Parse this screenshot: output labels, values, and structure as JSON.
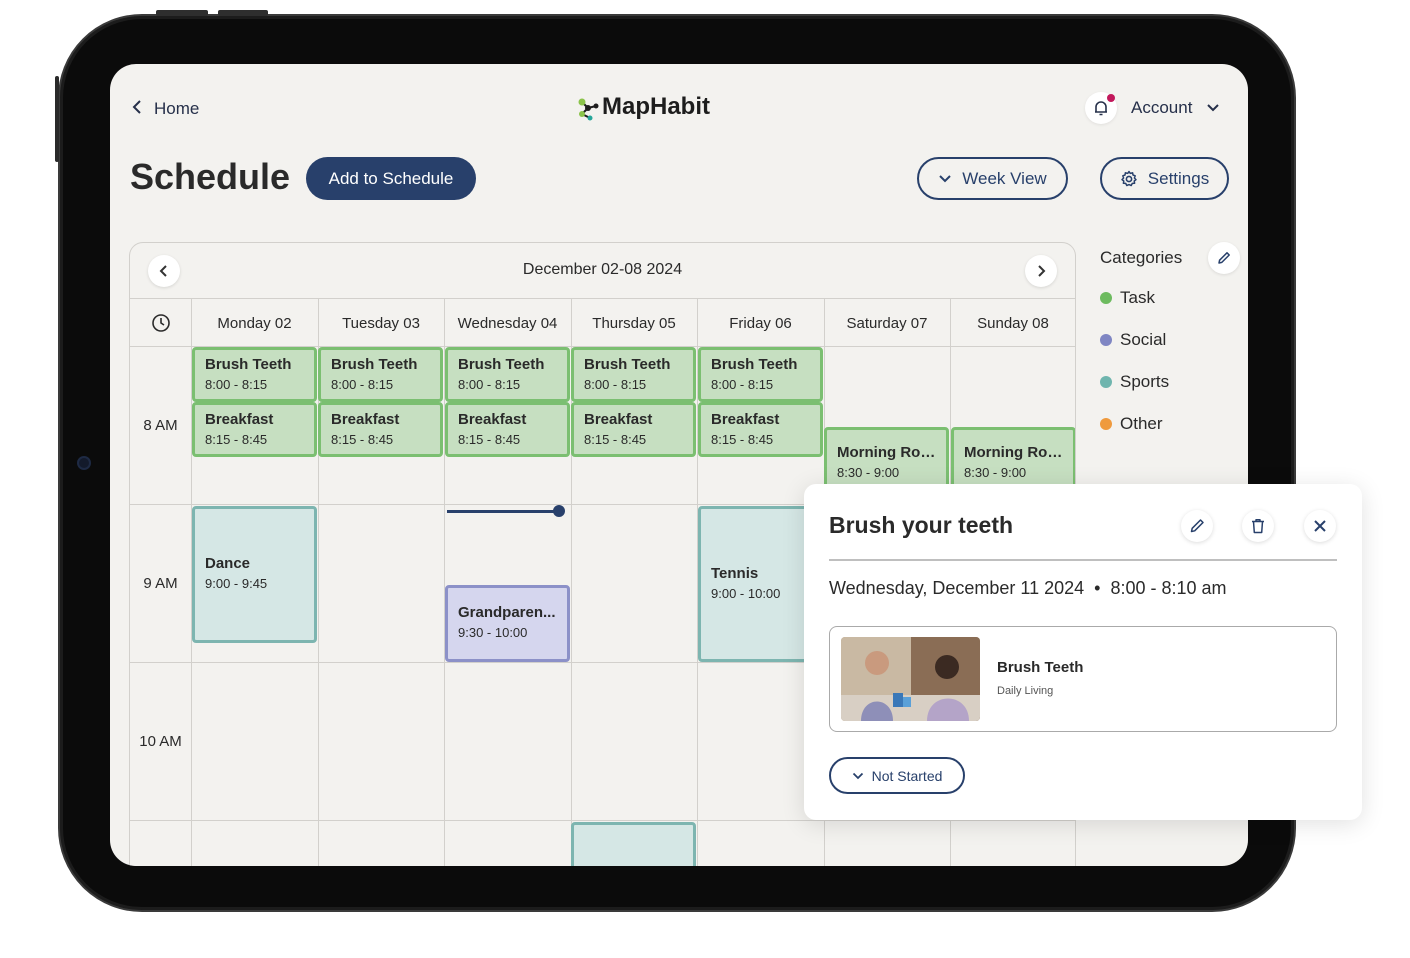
{
  "header": {
    "home_label": "Home",
    "brand": "MapHabit",
    "account_label": "Account"
  },
  "page": {
    "title": "Schedule",
    "add_button": "Add to Schedule",
    "view_button": "Week View",
    "settings_button": "Settings"
  },
  "calendar": {
    "range": "December 02-08 2024",
    "days": [
      "Monday 02",
      "Tuesday 03",
      "Wednesday 04",
      "Thursday 05",
      "Friday 06",
      "Saturday 07",
      "Sunday 08"
    ],
    "hours": [
      "8 AM",
      "9 AM",
      "10 AM"
    ],
    "events": [
      {
        "title": "Brush Teeth",
        "time": "8:00 - 8:15",
        "category": "Task"
      },
      {
        "title": "Breakfast",
        "time": "8:15 - 8:45",
        "category": "Task"
      },
      {
        "title": "Morning Rou...",
        "time": "8:30 - 9:00",
        "category": "Task"
      },
      {
        "title": "Dance",
        "time": "9:00 - 9:45",
        "category": "Sports"
      },
      {
        "title": "Grandparen...",
        "time": "9:30 - 10:00",
        "category": "Social"
      },
      {
        "title": "Tennis",
        "time": "9:00 - 10:00",
        "category": "Sports"
      }
    ]
  },
  "categories": {
    "heading": "Categories",
    "items": [
      {
        "label": "Task",
        "color": "#6dbb5f"
      },
      {
        "label": "Social",
        "color": "#7f86c3"
      },
      {
        "label": "Sports",
        "color": "#6fb5ae"
      },
      {
        "label": "Other",
        "color": "#ef9a3d"
      }
    ]
  },
  "popup": {
    "title": "Brush your teeth",
    "date": "Wednesday, December 11 2024",
    "separator": "•",
    "time": "8:00 - 8:10 am",
    "activity_name": "Brush Teeth",
    "activity_category": "Daily Living",
    "status": "Not Started"
  },
  "colors": {
    "primary": "#28406b",
    "task_fill": "#c6dfc1",
    "task_border": "#7bbf71",
    "sports_fill": "#d5e7e5",
    "sports_border": "#7db5b0",
    "social_fill": "#d5d6ee",
    "social_border": "#8c91c8"
  }
}
